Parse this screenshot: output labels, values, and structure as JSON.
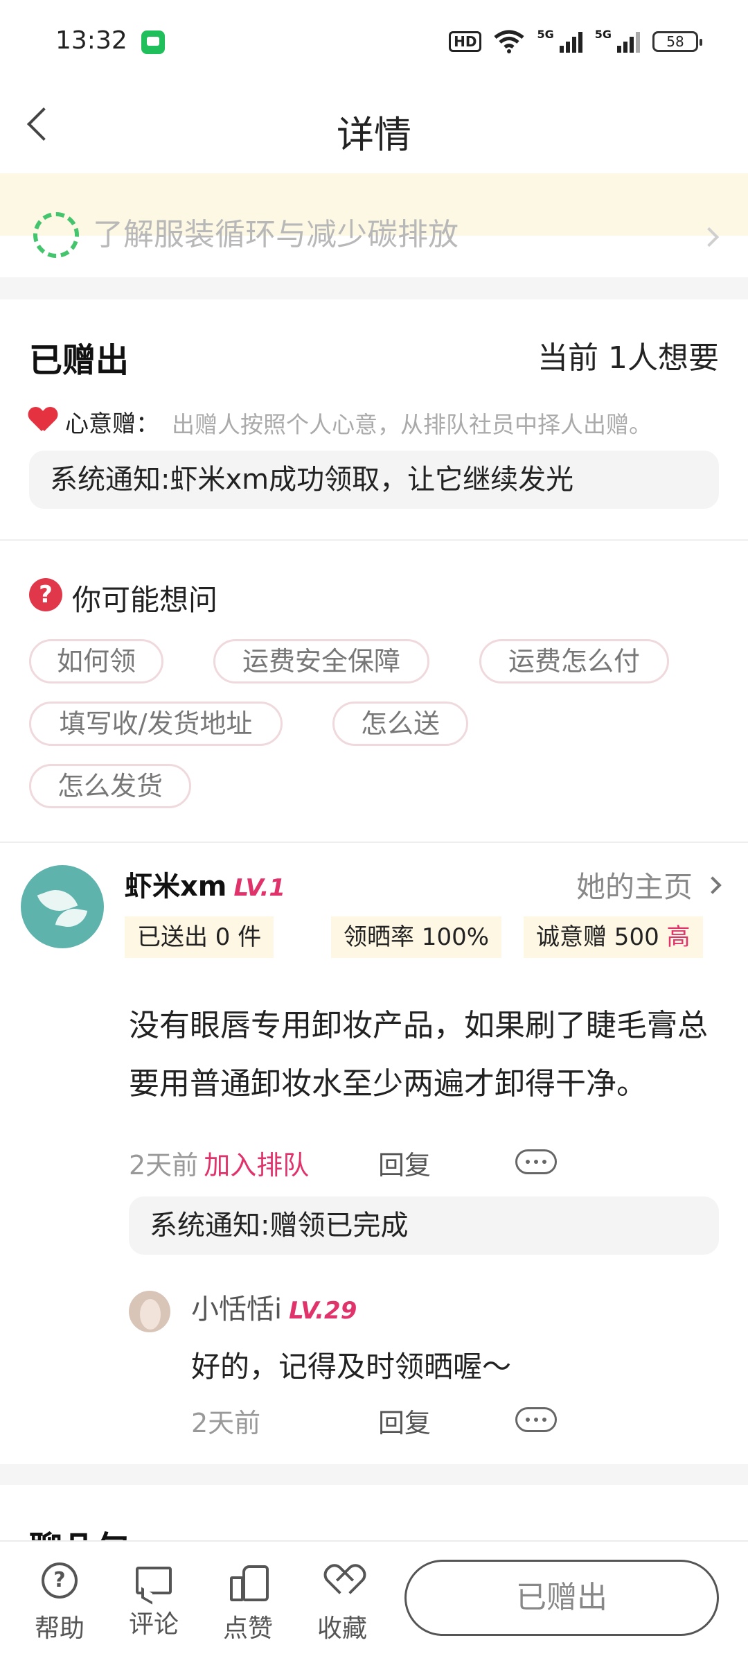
{
  "status_bar": {
    "time": "13:32",
    "network_hd": "HD",
    "network_5g_a": "5G",
    "network_5g_b": "5G",
    "battery": "58"
  },
  "header": {
    "title": "详情"
  },
  "banner": {
    "text": "了解服装循环与减少碳排放"
  },
  "status": {
    "title": "已赠出",
    "want_count": "当前 1人想要",
    "intent_label": "心意赠：",
    "intent_desc": "出赠人按照个人心意，从排队社员中择人出赠。",
    "notice": "系统通知:虾米xm成功领取，让它继续发光"
  },
  "faq": {
    "title": "你可能想问",
    "chips": [
      "如何领",
      "运费安全保障",
      "运费怎么付",
      "填写收/发货地址",
      "怎么送",
      "怎么发货"
    ]
  },
  "comment": {
    "user_name": "虾米xm",
    "user_level": "LV.1",
    "home_link": "她的主页",
    "stats": {
      "sent": "已送出 0 件",
      "share_rate": "领晒率 100%",
      "sincerity_label": "诚意赠 500",
      "sincerity_level": "高"
    },
    "body": "没有眼唇专用卸妆产品，如果刷了睫毛膏总要用普通卸妆水至少两遍才卸得干净。",
    "time": "2天前",
    "join_label": "加入排队",
    "reply_label": "回复",
    "notice": "系统通知:赠领已完成",
    "reply": {
      "user_name": "小恬恬i",
      "user_level": "LV.29",
      "body": "好的，记得及时领晒喔～",
      "time": "2天前",
      "reply_label": "回复"
    }
  },
  "next_section": {
    "title": "聊几句"
  },
  "bottom_bar": {
    "help": "帮助",
    "comment": "评论",
    "like": "点赞",
    "favorite": "收藏",
    "action_button": "已赠出"
  },
  "colors": {
    "accent_pink": "#e0336b",
    "heart_red": "#e53240",
    "banner_bg": "#fdf8e4",
    "stat_bg": "#fdf7e3",
    "recycle_green": "#45c46e"
  }
}
